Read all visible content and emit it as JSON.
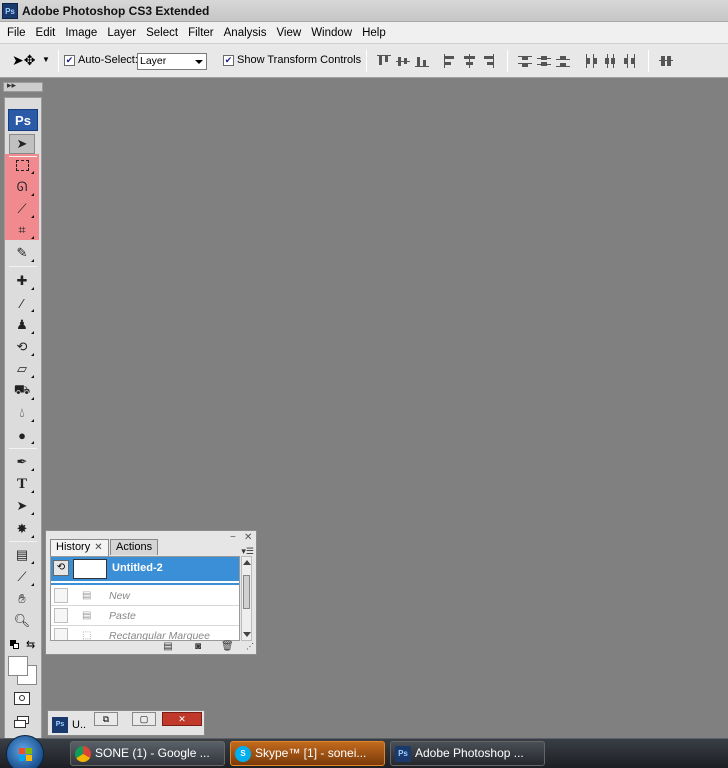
{
  "window": {
    "title": "Adobe Photoshop CS3 Extended",
    "logo": "Ps"
  },
  "menu": [
    "File",
    "Edit",
    "Image",
    "Layer",
    "Select",
    "Filter",
    "Analysis",
    "View",
    "Window",
    "Help"
  ],
  "options": {
    "auto_select_label": "Auto-Select:",
    "auto_select_checked": true,
    "auto_select_value": "Layer",
    "show_transform_label": "Show Transform Controls",
    "show_transform_checked": true
  },
  "toolbox": {
    "logo": "Ps",
    "tools": [
      "move-tool",
      "rectangular-marquee-tool",
      "lasso-tool",
      "magic-wand-tool",
      "crop-tool",
      "slice-tool",
      "healing-brush-tool",
      "brush-tool",
      "clone-stamp-tool",
      "history-brush-tool",
      "eraser-tool",
      "paint-bucket-tool",
      "blur-tool",
      "dodge-tool",
      "pen-tool",
      "type-tool",
      "path-selection-tool",
      "custom-shape-tool",
      "notes-tool",
      "eyedropper-tool",
      "hand-tool",
      "zoom-tool"
    ],
    "type_tool_glyph": "T",
    "highlight_color": "#f08a8e"
  },
  "history_panel": {
    "tabs": [
      "History",
      "Actions"
    ],
    "active_tab": "History",
    "snapshot": "Untitled-2",
    "items": [
      "New",
      "Paste",
      "Rectangular Marquee"
    ],
    "selection_color": "#3a8fd6"
  },
  "minimized_doc": {
    "name": "U.."
  },
  "taskbar": {
    "items": [
      {
        "label": "SONE (1) - Google ...",
        "icon": "chrome-icon"
      },
      {
        "label": "Skype™ [1] - sonei...",
        "icon": "skype-icon"
      },
      {
        "label": "Adobe Photoshop ...",
        "icon": "photoshop-icon"
      }
    ]
  }
}
